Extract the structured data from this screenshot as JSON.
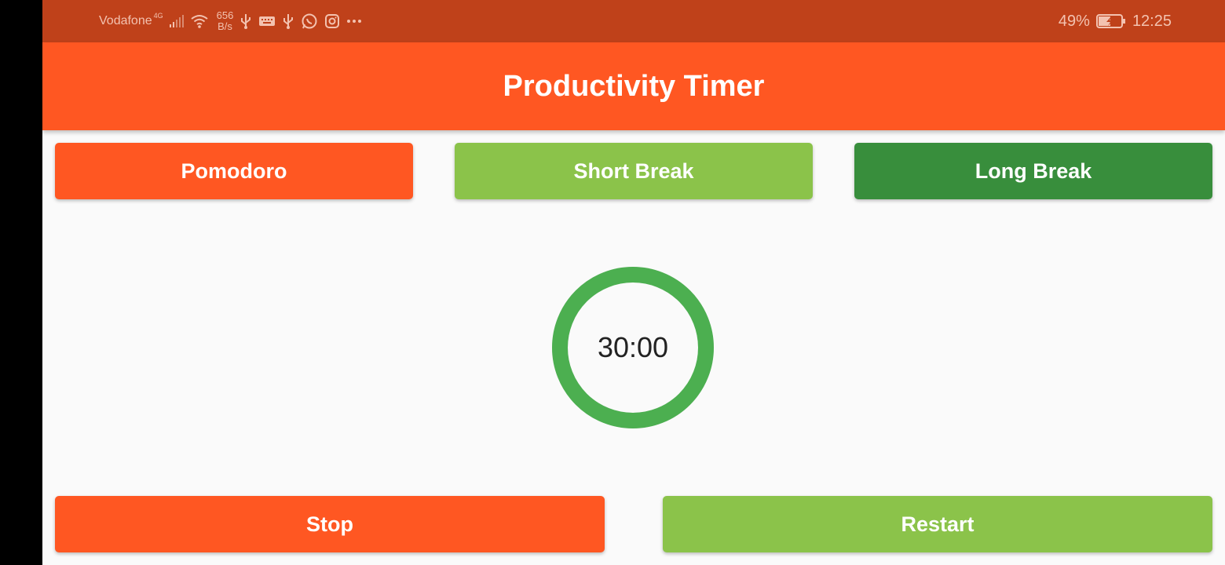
{
  "status_bar": {
    "carrier": "Vodafone",
    "network_type": "4G",
    "net_speed_value": "656",
    "net_speed_unit": "B/s",
    "battery": "49%",
    "time": "12:25",
    "icons": [
      "signal-icon",
      "wifi-icon",
      "usb-icon",
      "keyboard-icon",
      "usb-icon",
      "whatsapp-icon",
      "instagram-icon",
      "more-icon",
      "battery-charging-icon"
    ]
  },
  "app_bar": {
    "title": "Productivity Timer"
  },
  "modes": {
    "pomodoro": "Pomodoro",
    "short_break": "Short Break",
    "long_break": "Long Break"
  },
  "timer": {
    "display": "30:00",
    "progress": 1.0,
    "color": "#4caf50"
  },
  "controls": {
    "stop": "Stop",
    "restart": "Restart"
  },
  "colors": {
    "primary": "#ff5722",
    "status_bar": "#bf411a",
    "light_green": "#8bc34a",
    "dark_green": "#388e3c"
  }
}
